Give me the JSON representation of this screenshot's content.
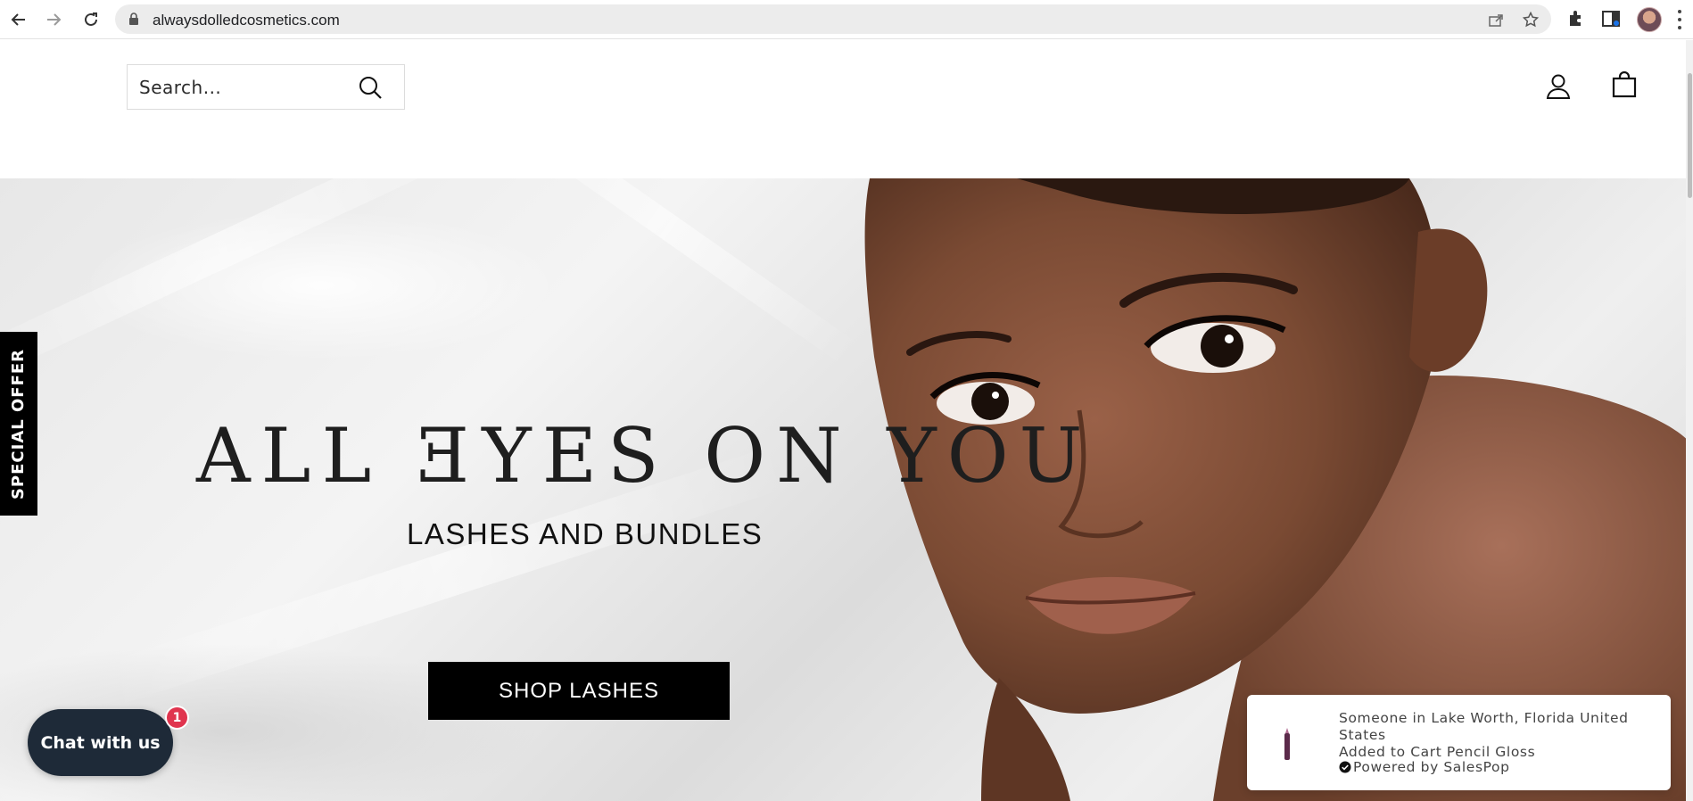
{
  "browser": {
    "url": "alwaysdolledcosmetics.com",
    "icons": [
      "back-arrow-icon",
      "forward-arrow-icon",
      "reload-icon",
      "lock-icon",
      "share-icon",
      "star-icon",
      "puzzle-icon",
      "sidebar-icon",
      "profile-avatar",
      "kebab-menu-icon"
    ]
  },
  "header": {
    "search_placeholder": "Search...",
    "icons": [
      "search-icon",
      "account-icon",
      "cart-bag-icon"
    ]
  },
  "hero": {
    "title": "ALL ƎYES ON YOU",
    "subtitle": "LASHES AND BUNDLES",
    "cta_label": "SHOP LASHES"
  },
  "special_offer": {
    "label": "SPECIAL OFFER"
  },
  "chat": {
    "label": "Chat with us",
    "badge_count": "1"
  },
  "toast": {
    "line1": "Someone in Lake Worth, Florida United",
    "line2": "States",
    "line3": "Added to Cart Pencil Gloss",
    "line4": "Powered by SalesPop"
  },
  "colors": {
    "accent": "#000000",
    "chat_bg": "#1e2a38",
    "badge": "#e0344e",
    "skin": "#7a4a33"
  }
}
